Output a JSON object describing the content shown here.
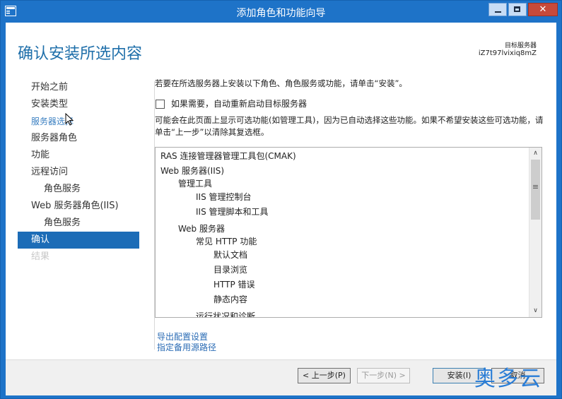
{
  "window": {
    "title": "添加角色和功能向导",
    "controls": [
      "minimize-icon",
      "maximize-icon",
      "close-icon"
    ],
    "accent": "#1e73c8"
  },
  "header": {
    "page_title": "确认安装所选内容",
    "target_label": "目标服务器",
    "target_name": "iZ7t97lvixiq8mZ"
  },
  "nav": {
    "items": [
      {
        "label": "开始之前",
        "state": "normal"
      },
      {
        "label": "安装类型",
        "state": "normal"
      },
      {
        "label": "服务器选择",
        "state": "link"
      },
      {
        "label": "服务器角色",
        "state": "normal"
      },
      {
        "label": "功能",
        "state": "normal"
      },
      {
        "label": "远程访问",
        "state": "normal"
      },
      {
        "label": "角色服务",
        "state": "sub"
      },
      {
        "label": "Web 服务器角色(IIS)",
        "state": "normal"
      },
      {
        "label": "角色服务",
        "state": "sub"
      },
      {
        "label": "确认",
        "state": "active"
      },
      {
        "label": "结果",
        "state": "disabled"
      }
    ]
  },
  "content": {
    "intro": "若要在所选服务器上安装以下角色、角色服务或功能，请单击“安装”。",
    "restart_checkbox": {
      "label": "如果需要，自动重新启动目标服务器",
      "checked": false
    },
    "info": "可能会在此页面上显示可选功能(如管理工具)，因为已自动选择这些功能。如果不希望安装这些可选功能，请单击“上一步”以清除其复选框。",
    "features": [
      {
        "label": "RAS 连接管理器管理工具包(CMAK)",
        "level": 0
      },
      {
        "label": "Web 服务器(IIS)",
        "level": 0
      },
      {
        "label": "管理工具",
        "level": 1
      },
      {
        "label": "IIS 管理控制台",
        "level": 2
      },
      {
        "label": "IIS 管理脚本和工具",
        "level": 2
      },
      {
        "label": "Web 服务器",
        "level": 1
      },
      {
        "label": "常见 HTTP 功能",
        "level": 2
      },
      {
        "label": "默认文档",
        "level": 3
      },
      {
        "label": "目录浏览",
        "level": 3
      },
      {
        "label": "HTTP 错误",
        "level": 3
      },
      {
        "label": "静态内容",
        "level": 3
      },
      {
        "label": "运行状况和诊断",
        "level": 2
      }
    ],
    "export_link": "导出配置设置",
    "source_link": "指定备用源路径"
  },
  "footer": {
    "prev_label": "< 上一步(P)",
    "next_label": "下一步(N) >",
    "install_label": "安装(I)",
    "cancel_label": "取消"
  },
  "watermark": "奥多云"
}
